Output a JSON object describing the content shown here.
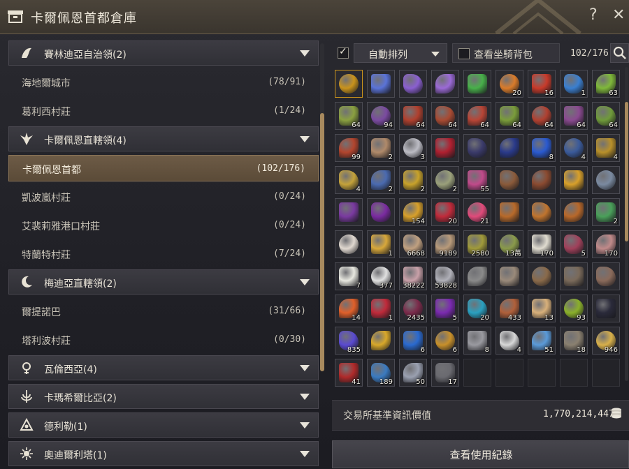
{
  "window": {
    "title": "卡爾佩恩首都倉庫"
  },
  "regions": [
    {
      "name": "賽林迪亞自治領(2)",
      "icon": "serendia-emblem-icon",
      "towns": [
        {
          "name": "海地爾城市",
          "count": "(78/91)"
        },
        {
          "name": "葛利西村莊",
          "count": "(1/24)"
        }
      ]
    },
    {
      "name": "卡爾佩恩直轄領(4)",
      "icon": "calpheon-emblem-icon",
      "towns": [
        {
          "name": "卡爾佩恩首都",
          "count": "(102/176)",
          "selected": true
        },
        {
          "name": "凱波嵐村莊",
          "count": "(0/24)"
        },
        {
          "name": "艾裴莉雅港口村莊",
          "count": "(0/24)"
        },
        {
          "name": "特蘭特村莊",
          "count": "(7/24)"
        }
      ]
    },
    {
      "name": "梅迪亞直轄領(2)",
      "icon": "mediah-moon-emblem-icon",
      "towns": [
        {
          "name": "爾提諾巴",
          "count": "(31/66)"
        },
        {
          "name": "塔利波村莊",
          "count": "(0/30)"
        }
      ]
    },
    {
      "name": "瓦倫西亞(4)",
      "icon": "valencia-emblem-icon",
      "towns": []
    },
    {
      "name": "卡瑪希爾比亞(2)",
      "icon": "kamasylvia-emblem-icon",
      "towns": []
    },
    {
      "name": "德利勒(1)",
      "icon": "drieghan-emblem-icon",
      "towns": []
    },
    {
      "name": "奧迪爾利塔(1)",
      "icon": "odyllita-emblem-icon",
      "towns": []
    }
  ],
  "toolbar": {
    "auto_sort_label": "自動排列",
    "auto_sort_checked": true,
    "mount_bag_label": "查看坐騎背包",
    "mount_bag_checked": false,
    "capacity": "102/176"
  },
  "items": [
    {
      "icon": "gold-seal-icon",
      "color": "#c9931c",
      "count": ""
    },
    {
      "icon": "blue-crystal-icon",
      "color": "#5a73d8",
      "count": ""
    },
    {
      "icon": "purple-crystal-icon",
      "color": "#8a5fd0",
      "count": ""
    },
    {
      "icon": "purple-crystal-icon",
      "color": "#9b6ad6",
      "count": ""
    },
    {
      "icon": "green-crystal-icon",
      "color": "#48b04a",
      "count": ""
    },
    {
      "icon": "orange-potion-icon",
      "color": "#d97b2a",
      "count": "20"
    },
    {
      "icon": "red-potion-icon",
      "color": "#c83a2a",
      "count": "16"
    },
    {
      "icon": "blue-potion-icon",
      "color": "#3a7fd0",
      "count": "1"
    },
    {
      "icon": "green-elixir-icon",
      "color": "#7fb83a",
      "count": "63"
    },
    {
      "icon": "green-elixir-icon",
      "color": "#8aa040",
      "count": "64"
    },
    {
      "icon": "purple-elixir-icon",
      "color": "#7a4aa0",
      "count": "94"
    },
    {
      "icon": "red-elixir-icon",
      "color": "#b0402e",
      "count": "64"
    },
    {
      "icon": "red-elixir-icon",
      "color": "#a84a32",
      "count": "64"
    },
    {
      "icon": "red-elixir-icon",
      "color": "#b84536",
      "count": "64"
    },
    {
      "icon": "green-elixir-icon",
      "color": "#7a9c3a",
      "count": "64"
    },
    {
      "icon": "red-elixir-icon",
      "color": "#b04030",
      "count": "64"
    },
    {
      "icon": "purple-elixir-icon",
      "color": "#8a4a90",
      "count": "64"
    },
    {
      "icon": "green-elixir-icon",
      "color": "#6f9a3a",
      "count": "64"
    },
    {
      "icon": "red-elixir-icon",
      "color": "#b2452e",
      "count": "99"
    },
    {
      "icon": "clay-jar-icon",
      "color": "#b08a6a",
      "count": "2"
    },
    {
      "icon": "silver-chest-icon",
      "color": "#bcbcc4",
      "count": "3"
    },
    {
      "icon": "red-shard-icon",
      "color": "#b02030",
      "count": ""
    },
    {
      "icon": "black-stone-icon",
      "color": "#3a3a6a",
      "count": ""
    },
    {
      "icon": "black-stone-icon",
      "color": "#2a3a8a",
      "count": ""
    },
    {
      "icon": "blue-flame-icon",
      "color": "#2a5ad0",
      "count": "8"
    },
    {
      "icon": "blue-scroll-icon",
      "color": "#3a5a9a",
      "count": "4"
    },
    {
      "icon": "gold-scroll-icon",
      "color": "#b8902a",
      "count": "4"
    },
    {
      "icon": "gold-scroll-icon",
      "color": "#c4a23a",
      "count": "4"
    },
    {
      "icon": "blue-scroll-icon",
      "color": "#4a6ab0",
      "count": "2"
    },
    {
      "icon": "gold-card-icon",
      "color": "#c8a22a",
      "count": "2"
    },
    {
      "icon": "ticket-icon",
      "color": "#9aa07a",
      "count": "2"
    },
    {
      "icon": "rainbow-orb-icon",
      "color": "#c04a8a",
      "count": "55"
    },
    {
      "icon": "wooden-chest-icon",
      "color": "#8a5a3a",
      "count": ""
    },
    {
      "icon": "wooden-chest-icon",
      "color": "#8a4a30",
      "count": ""
    },
    {
      "icon": "gold-box-icon",
      "color": "#d8a02a",
      "count": ""
    },
    {
      "icon": "silver-box-icon",
      "color": "#7a8aa0",
      "count": ""
    },
    {
      "icon": "purple-box-icon",
      "color": "#7a3aa0",
      "count": ""
    },
    {
      "icon": "purple-gem-icon",
      "color": "#7a2aa0",
      "count": ""
    },
    {
      "icon": "gold-scroll-icon",
      "color": "#d8a02a",
      "count": "154"
    },
    {
      "icon": "red-rose-icon",
      "color": "#c02a3a",
      "count": "20"
    },
    {
      "icon": "pink-potion-icon",
      "color": "#e04a7a",
      "count": "21"
    },
    {
      "icon": "treasure-chest-icon",
      "color": "#b86a2a",
      "count": ""
    },
    {
      "icon": "treasure-chest-icon",
      "color": "#c0742e",
      "count": ""
    },
    {
      "icon": "treasure-chest-icon",
      "color": "#b8682a",
      "count": ""
    },
    {
      "icon": "gift-box-icon",
      "color": "#4aa05a",
      "count": "2"
    },
    {
      "icon": "cake-icon",
      "color": "#e0d8d0",
      "count": ""
    },
    {
      "icon": "golden-feather-icon",
      "color": "#d8a83a",
      "count": "1"
    },
    {
      "icon": "ore-pile-icon",
      "color": "#c0a080",
      "count": "6668"
    },
    {
      "icon": "stone-icon",
      "color": "#b89a7a",
      "count": "9189"
    },
    {
      "icon": "herb-icon",
      "color": "#a09a3a",
      "count": "2580"
    },
    {
      "icon": "herb-icon",
      "color": "#8a9a4a",
      "count": "13萬"
    },
    {
      "icon": "white-flower-icon",
      "color": "#e0dcd0",
      "count": "170"
    },
    {
      "icon": "pink-crystal-icon",
      "color": "#a0405a",
      "count": "5"
    },
    {
      "icon": "pink-stone-icon",
      "color": "#c08a8a",
      "count": "170"
    },
    {
      "icon": "white-powder-icon",
      "color": "#e8e8e0",
      "count": "7"
    },
    {
      "icon": "silver-ore-icon",
      "color": "#e0e0e0",
      "count": "377"
    },
    {
      "icon": "pink-ore-icon",
      "color": "#c8a0a8",
      "count": "38222"
    },
    {
      "icon": "grey-ore-icon",
      "color": "#b0b0b8",
      "count": "53828"
    },
    {
      "icon": "anvil-tools-icon",
      "color": "#8a8a8a",
      "count": ""
    },
    {
      "icon": "anvil-tools-icon",
      "color": "#9a8a7a",
      "count": ""
    },
    {
      "icon": "bronze-relic-icon",
      "color": "#8a6a4a",
      "count": ""
    },
    {
      "icon": "bronze-relic-icon",
      "color": "#7a6a5a",
      "count": ""
    },
    {
      "icon": "bronze-relic-icon",
      "color": "#8a6a5a",
      "count": ""
    },
    {
      "icon": "flame-burst-icon",
      "color": "#e0602a",
      "count": "14"
    },
    {
      "icon": "red-gem-icon",
      "color": "#c02a3a",
      "count": "1"
    },
    {
      "icon": "dark-ring-icon",
      "color": "#7a2a4a",
      "count": "2435"
    },
    {
      "icon": "purple-orb-icon",
      "color": "#7a2ab0",
      "count": "5"
    },
    {
      "icon": "cyan-orb-icon",
      "color": "#2aa0c0",
      "count": "20"
    },
    {
      "icon": "copper-shell-icon",
      "color": "#b0603a",
      "count": "433"
    },
    {
      "icon": "seed-icon",
      "color": "#d8b07a",
      "count": "13"
    },
    {
      "icon": "green-rune-icon",
      "color": "#8ab02a",
      "count": "93"
    },
    {
      "icon": "black-crystal-icon",
      "color": "#2a2a3a",
      "count": ""
    },
    {
      "icon": "purple-portal-icon",
      "color": "#5a4ad0",
      "count": "835"
    },
    {
      "icon": "gold-bar-icon",
      "color": "#d8a82a",
      "count": ""
    },
    {
      "icon": "sapphire-brooch-icon",
      "color": "#2a6ad0",
      "count": "6"
    },
    {
      "icon": "gold-box-icon",
      "color": "#c8902a",
      "count": "6"
    },
    {
      "icon": "steel-pipe-icon",
      "color": "#9a9aa0",
      "count": "8"
    },
    {
      "icon": "dice-icon",
      "color": "#d8d8d8",
      "count": "4"
    },
    {
      "icon": "blue-shard-icon",
      "color": "#5a9ad8",
      "count": "51"
    },
    {
      "icon": "iron-chest-icon",
      "color": "#8a8070",
      "count": "18"
    },
    {
      "icon": "gold-pile-icon",
      "color": "#d8b04a",
      "count": "946"
    },
    {
      "icon": "red-claw-icon",
      "color": "#b02a2a",
      "count": "41"
    },
    {
      "icon": "blue-leaf-icon",
      "color": "#3a7ac0",
      "count": "189"
    },
    {
      "icon": "silver-leaf-icon",
      "color": "#9aa0b0",
      "count": "50"
    },
    {
      "icon": "grey-ingot-icon",
      "color": "#6a6a70",
      "count": "17"
    }
  ],
  "valuation": {
    "label": "交易所基準資訊價值",
    "value": "1,770,214,447"
  },
  "history_button": "查看使用紀錄"
}
